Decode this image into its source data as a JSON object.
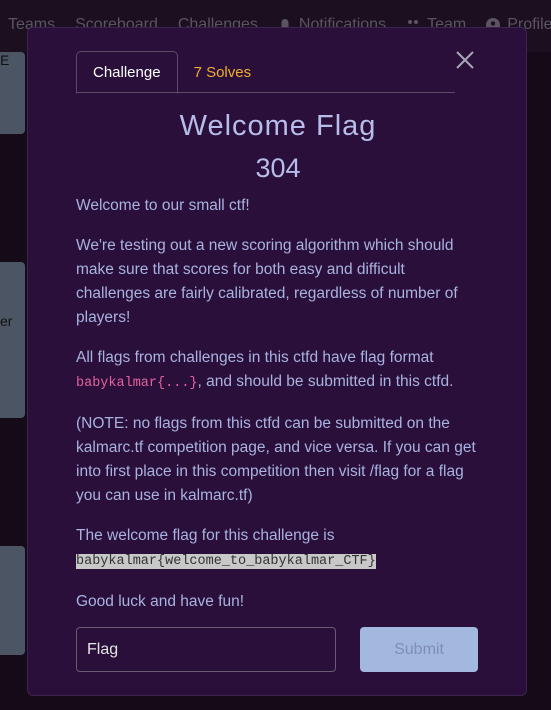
{
  "navbar": {
    "items": [
      {
        "label": "Teams",
        "icon": ""
      },
      {
        "label": "Scoreboard",
        "icon": ""
      },
      {
        "label": "Challenges",
        "icon": ""
      },
      {
        "label": "Notifications",
        "icon": "bell-icon"
      },
      {
        "label": "Team",
        "icon": "users-icon"
      },
      {
        "label": "Profile",
        "icon": "user-circle-icon"
      }
    ]
  },
  "background_cards": {
    "texts": [
      "E",
      "er"
    ]
  },
  "modal": {
    "tabs": [
      {
        "label": "Challenge",
        "active": true
      },
      {
        "label": "7 Solves",
        "active": false
      }
    ],
    "title": "Welcome Flag",
    "value": "304",
    "description": {
      "p1": "Welcome to our small ctf!",
      "p2": "We're testing out a new scoring algorithm which should make sure that scores for both easy and difficult challenges are fairly calibrated, regardless of number of players!",
      "p3_before": "All flags from challenges in this ctfd have flag format ",
      "p3_code": "babykalmar{...}",
      "p3_after": ", and should be submitted in this ctfd.",
      "p4": "(NOTE: no flags from this ctfd can be submitted on the kalmarc.tf competition page, and vice versa. If you can get into first place in this competition then visit /flag for a flag you can use in kalmarc.tf)",
      "p5_text": "The welcome flag for this challenge is",
      "p5_flag": "babykalmar{welcome_to_babykalmar_CTF}",
      "p6": "Good luck and have fun!"
    },
    "flag_input": {
      "placeholder": "Flag",
      "value": ""
    },
    "submit_label": "Submit"
  },
  "colors": {
    "modal_bg": "#2a0f3a",
    "accent_text": "#b7bce8",
    "solves_color": "#f0ad2d",
    "code_color": "#e661a0",
    "submit_bg": "#a3b8df"
  }
}
